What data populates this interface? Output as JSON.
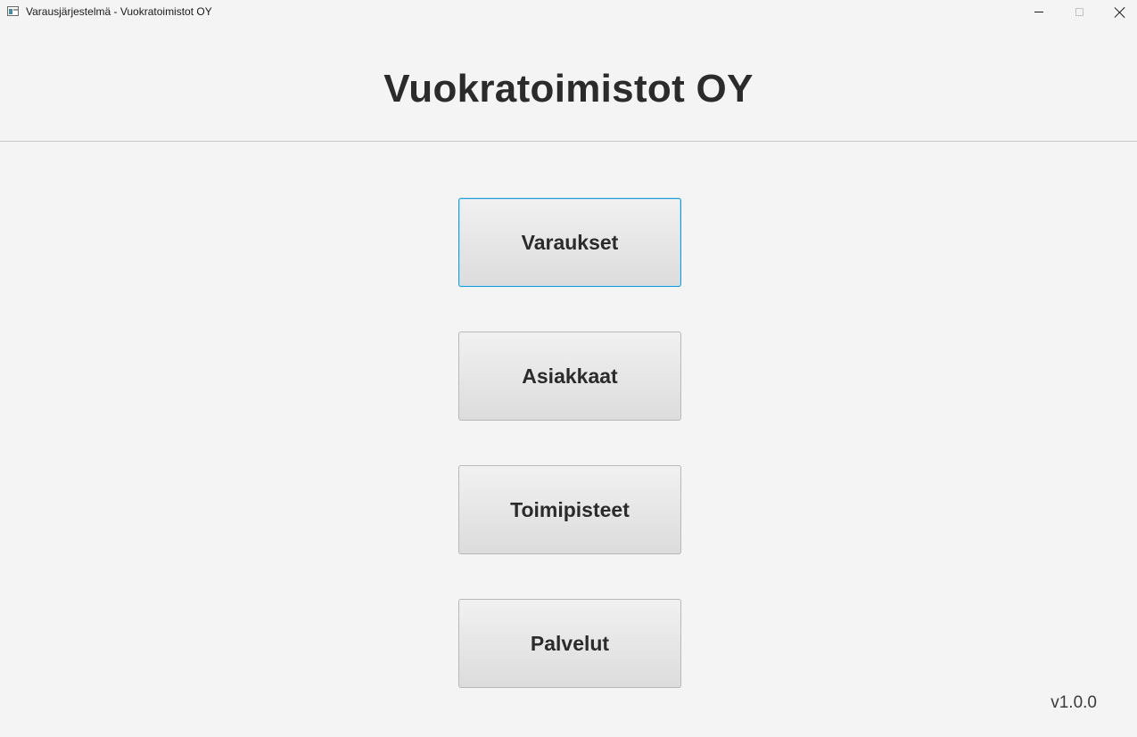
{
  "window": {
    "title": "Varausjärjestelmä - Vuokratoimistot OY",
    "controls": [
      "minimize-icon",
      "maximize-icon",
      "close-icon"
    ]
  },
  "header": {
    "title": "Vuokratoimistot OY"
  },
  "menu": {
    "buttons": [
      {
        "label": "Varaukset",
        "focused": true
      },
      {
        "label": "Asiakkaat"
      },
      {
        "label": "Toimipisteet"
      },
      {
        "label": "Palvelut"
      }
    ]
  },
  "footer": {
    "version": "v1.0.0"
  },
  "colors": {
    "background": "#f4f4f4",
    "focus_border": "#1e9ad6",
    "text": "#2b2b2b"
  }
}
